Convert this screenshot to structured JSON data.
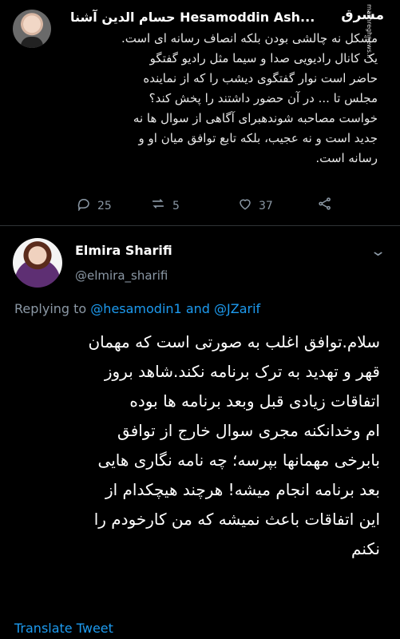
{
  "tweet1": {
    "author_name": "حسام الدین آشنا Hesamoddin Ash...",
    "watermark": "مشرق",
    "watermark_sub": "mashreghnews.ir",
    "body_lines": [
      "مشکل نه چالشی بودن بلکه انصاف رسانه ای است.",
      "یک کانال رادیویی صدا و سیما مثل رادیو گفتگو",
      "حاضر است نوار گفتگوی دیشب را که از نماینده",
      "مجلس تا ... در آن حضور داشتند را پخش کند؟",
      "خواست مصاحبه شوندهبرای آگاهی از سوال ها نه",
      "جدید است و نه عجیب، بلکه تابع توافق میان او و",
      "رسانه است."
    ],
    "reply_count": "25",
    "retweet_count": "5",
    "like_count": "37"
  },
  "tweet2": {
    "author_name": "Elmira Sharifi",
    "handle": "@elmira_sharifi",
    "replying_prefix": "Replying to",
    "reply_handle_1": "@hesamodin1",
    "reply_and": "and",
    "reply_handle_2": "@JZarif",
    "body_lines": [
      "سلام.توافق اغلب به صورتی است که مهمان",
      "قهر و تهدید به ترک برنامه نکند.شاهد بروز",
      "اتفاقات زیادی قبل وبعد برنامه ها بوده",
      "ام وخدانکنه مجری سوال خارج از توافق",
      "بابرخی مهمانها بپرسه؛ چه نامه نگاری هایی",
      "بعد برنامه انجام میشه! هرچند هیچکدام از",
      "این اتفاقات باعث نمیشه که من کارخودم را",
      "نکنم"
    ],
    "translate_label": "Translate Tweet"
  },
  "icons": {
    "reply": "reply-icon",
    "retweet": "retweet-icon",
    "like": "heart-icon",
    "share": "share-icon",
    "more": "chevron-down-icon"
  },
  "colors": {
    "background": "#000000",
    "text": "#ffffff",
    "secondary": "#8b98a5",
    "link": "#1d9bf0",
    "divider": "#2f3336"
  }
}
